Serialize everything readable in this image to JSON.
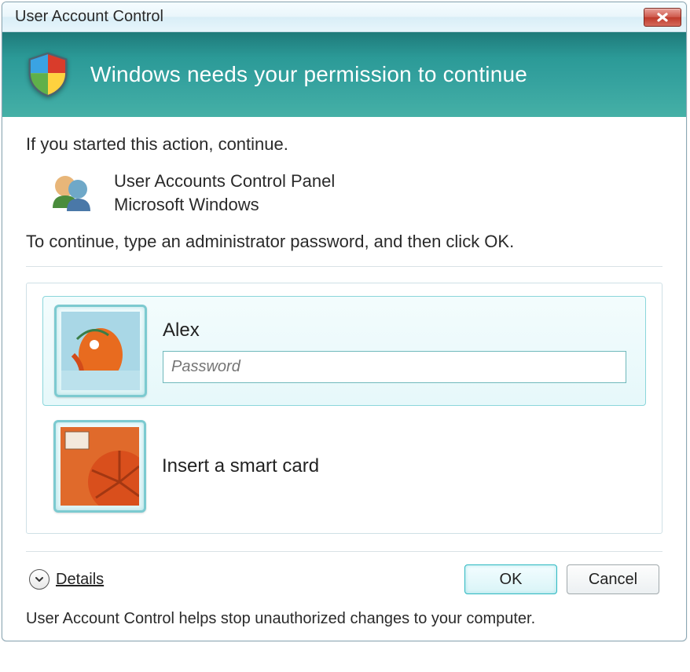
{
  "titlebar": {
    "title": "User Account Control"
  },
  "header": {
    "heading": "Windows needs your permission to continue"
  },
  "body": {
    "instruction1": "If you started this action, continue.",
    "app_name": "User Accounts Control Panel",
    "publisher": "Microsoft Windows",
    "instruction2": "To continue, type an administrator password, and then click OK."
  },
  "credentials": {
    "user": {
      "name": "Alex",
      "password_placeholder": "Password"
    },
    "smartcard": {
      "label": "Insert a smart card"
    }
  },
  "buttons": {
    "details": "Details",
    "ok": "OK",
    "cancel": "Cancel"
  },
  "footer": {
    "note": "User Account Control helps stop unauthorized changes to your computer."
  }
}
